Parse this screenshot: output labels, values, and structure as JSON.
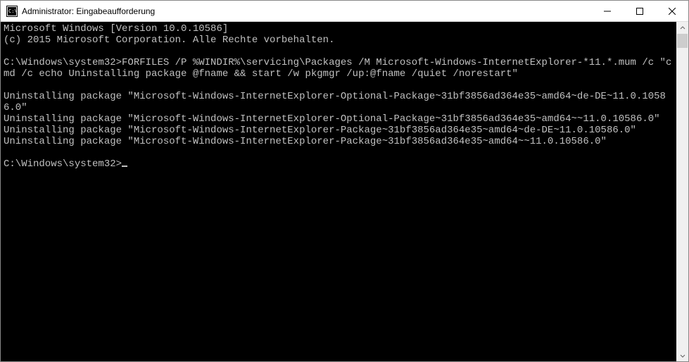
{
  "titlebar": {
    "title": "Administrator: Eingabeaufforderung"
  },
  "console": {
    "line1": "Microsoft Windows [Version 10.0.10586]",
    "line2": "(c) 2015 Microsoft Corporation. Alle Rechte vorbehalten.",
    "blank1": "",
    "prompt1": "C:\\Windows\\system32>",
    "command": "FORFILES /P %WINDIR%\\servicing\\Packages /M Microsoft-Windows-InternetExplorer-*11.*.mum /c \"cmd /c echo Uninstalling package @fname && start /w pkgmgr /up:@fname /quiet /norestart\"",
    "blank2": "",
    "out1": "Uninstalling package \"Microsoft-Windows-InternetExplorer-Optional-Package~31bf3856ad364e35~amd64~de-DE~11.0.10586.0\"",
    "out2": "Uninstalling package \"Microsoft-Windows-InternetExplorer-Optional-Package~31bf3856ad364e35~amd64~~11.0.10586.0\"",
    "out3": "Uninstalling package \"Microsoft-Windows-InternetExplorer-Package~31bf3856ad364e35~amd64~de-DE~11.0.10586.0\"",
    "out4": "Uninstalling package \"Microsoft-Windows-InternetExplorer-Package~31bf3856ad364e35~amd64~~11.0.10586.0\"",
    "blank3": "",
    "prompt2": "C:\\Windows\\system32>"
  }
}
